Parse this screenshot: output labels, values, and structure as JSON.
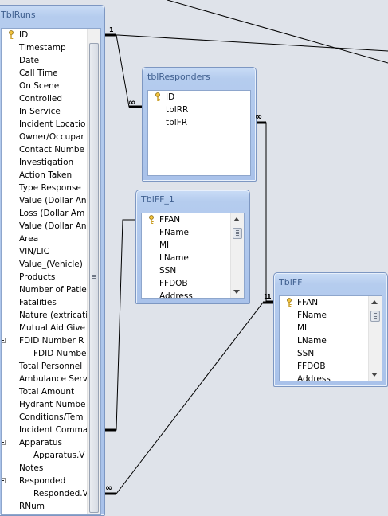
{
  "tables": {
    "runs": {
      "title": "TblRuns",
      "fields": [
        "ID",
        "Timestamp",
        "Date",
        "Call Time",
        "On Scene",
        "Controlled",
        "In Service",
        "Incident Locatio",
        "Owner/Occupar",
        "Contact Numbe",
        "Investigation",
        "Action Taken",
        "Type Response",
        "Value (Dollar An",
        "Loss (Dollar Am",
        "Value (Dollar An",
        "Area",
        "VIN/LIC",
        "Value_(Vehicle)",
        "Products",
        "Number of Patie",
        "Fatalities",
        "Nature (extricati",
        "Mutual Aid Give",
        "FDID Number R",
        "FDID Numbe",
        "Total Personnel",
        "Ambulance Serv",
        "Total Amount",
        "Hydrant Numbe",
        "Conditions/Tem",
        "Incident Comma",
        "Apparatus",
        "Apparatus.V",
        "Notes",
        "Responded",
        "Responded.V",
        "RNum"
      ]
    },
    "responders": {
      "title": "tblResponders",
      "fields": [
        "ID",
        "tblRR",
        "tblFR"
      ]
    },
    "iff1": {
      "title": "TblFF_1",
      "fields": [
        "FFAN",
        "FName",
        "MI",
        "LName",
        "SSN",
        "FFDOB",
        "Address"
      ]
    },
    "iff": {
      "title": "TblFF",
      "fields": [
        "FFAN",
        "FName",
        "MI",
        "LName",
        "SSN",
        "FFDOB",
        "Address"
      ]
    }
  },
  "relationships": {
    "one_symbol": "1",
    "many_symbol": "∞"
  },
  "icons": {
    "primary_key": "key-icon",
    "collapse": "minus-box-icon"
  },
  "colors": {
    "canvas": "#dfe3ea",
    "table_header": "#b5ccee",
    "table_title_text": "#3f5f8f"
  }
}
